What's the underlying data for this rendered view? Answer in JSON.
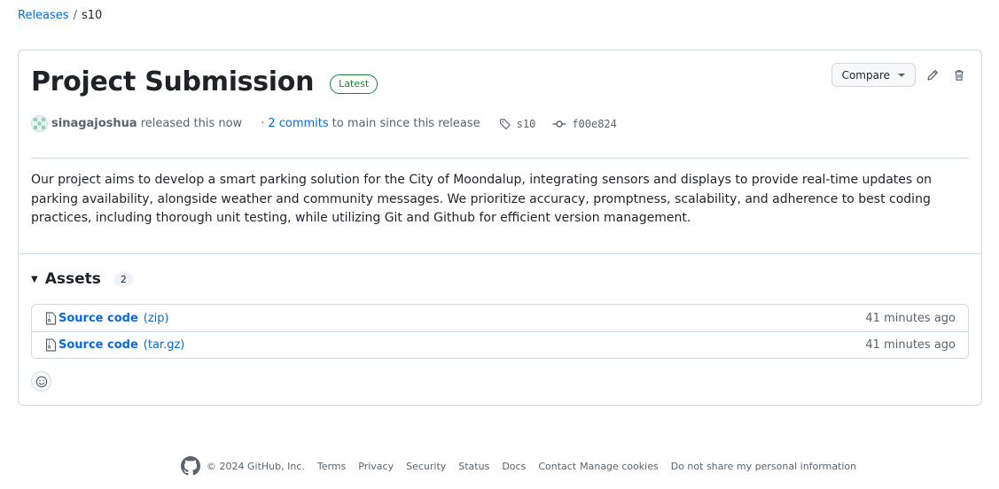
{
  "breadcrumb": {
    "releases": "Releases",
    "separator": "/",
    "current": "s10"
  },
  "release": {
    "title": "Project Submission",
    "badge": "Latest",
    "author": "sinagajoshua",
    "released_text": "released this now",
    "commits_prefix": "·",
    "commits_link": "2 commits",
    "commits_suffix": "to main since this release",
    "tag": "s10",
    "commit_sha": "f00e824",
    "description": "Our project aims to develop a smart parking solution for the City of Moondalup, integrating sensors and displays to provide real-time updates on parking availability, alongside weather and community messages. We prioritize accuracy, promptness, scalability, and adherence to best coding practices, including thorough unit testing, while utilizing Git and Github for efficient version management."
  },
  "actions": {
    "compare_label": "Compare",
    "edit_icon": "pencil-icon",
    "delete_icon": "trash-icon"
  },
  "assets": {
    "title": "Assets",
    "count": "2",
    "items": [
      {
        "name": "Source code",
        "ext": "(zip)",
        "time": "41 minutes ago"
      },
      {
        "name": "Source code",
        "ext": "(tar.gz)",
        "time": "41 minutes ago"
      }
    ]
  },
  "footer": {
    "copyright": "© 2024 GitHub, Inc.",
    "links": [
      "Terms",
      "Privacy",
      "Security",
      "Status",
      "Docs",
      "Contact",
      "Manage cookies",
      "Do not share my personal information"
    ]
  },
  "colors": {
    "link": "#0969da",
    "latest": "#1a7f37",
    "border": "#d1d9e0",
    "muted": "#59636e"
  }
}
